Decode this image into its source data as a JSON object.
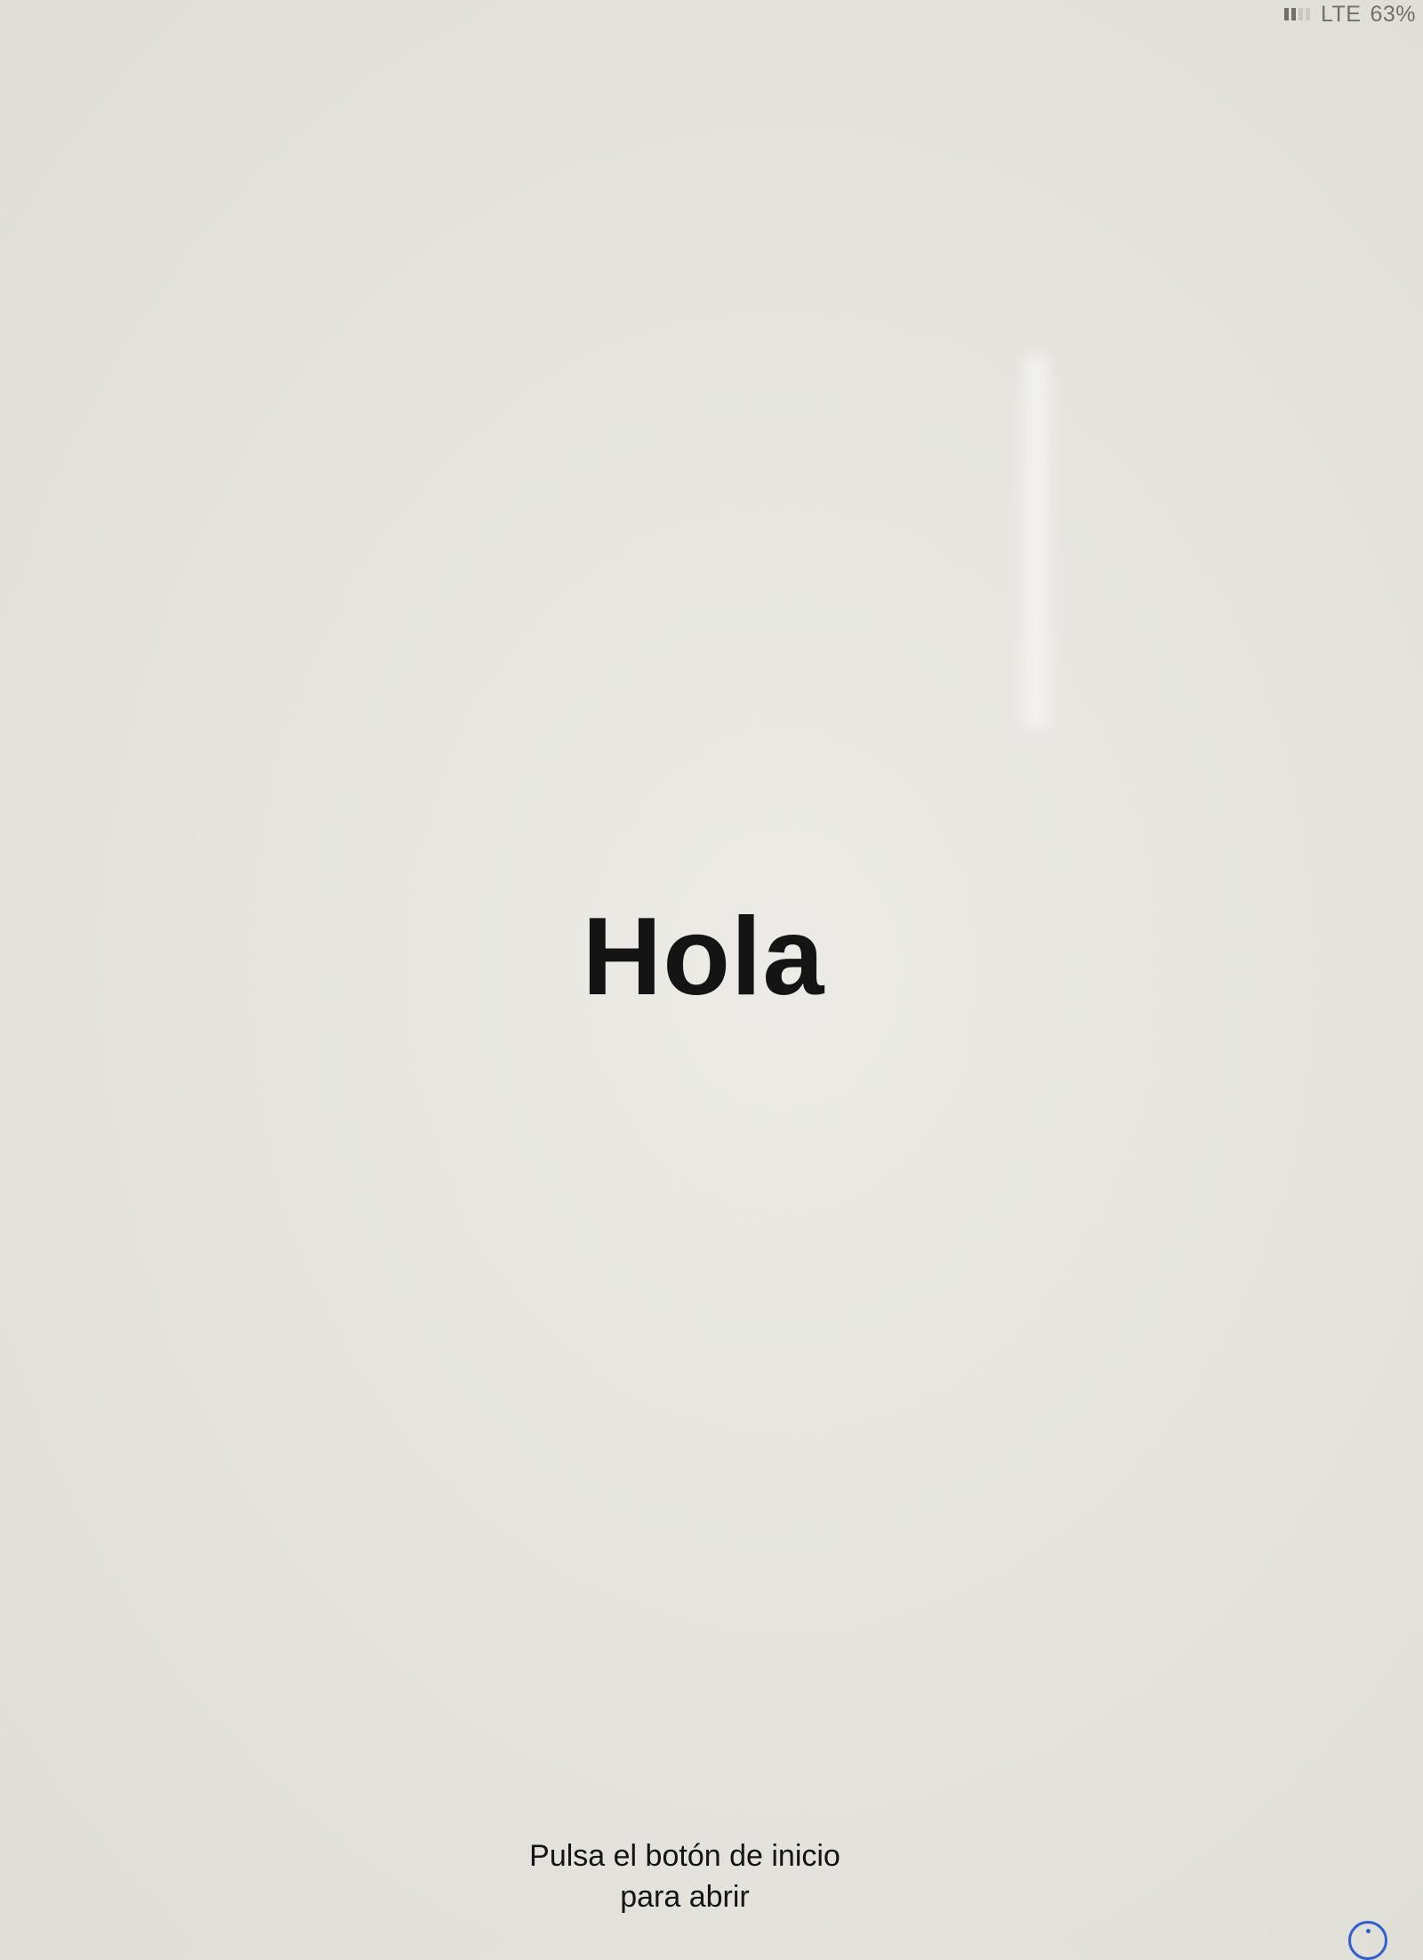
{
  "status_bar": {
    "signal_bars_active": 2,
    "signal_bars_total": 4,
    "network": "LTE",
    "battery": "63%"
  },
  "greeting": {
    "text": "Hola"
  },
  "instruction": {
    "line1": "Pulsa el botón de inicio",
    "line2": "para abrir"
  },
  "accessibility": {
    "icon": "accessibility-icon",
    "color": "#2f5fd0"
  }
}
